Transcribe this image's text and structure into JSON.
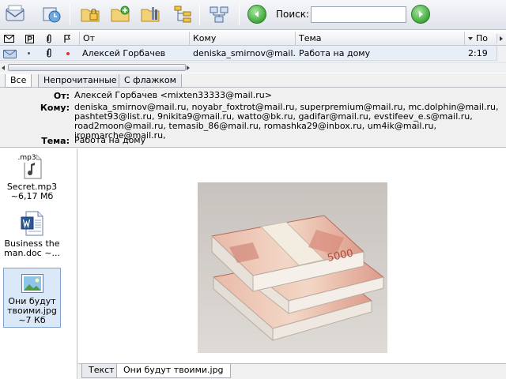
{
  "toolbar": {
    "buttons": [
      {
        "name": "mail-icon"
      },
      {
        "name": "sync-icon"
      },
      {
        "name": "lock-folder-icon"
      },
      {
        "name": "add-folder-icon"
      },
      {
        "name": "folder-settings-icon"
      },
      {
        "name": "tree-icon"
      },
      {
        "name": "network-icon"
      }
    ],
    "search_label": "Поиск:",
    "search_value": "",
    "search_placeholder": ""
  },
  "list": {
    "columns": {
      "from": "От",
      "to": "Кому",
      "subject": "Тема",
      "time": "По"
    },
    "rows": [
      {
        "from": "Алексей Горбачев",
        "to": "deniska_smirnov@mail....",
        "subject": "Работа на дому",
        "time": "2:19"
      }
    ]
  },
  "filters": {
    "all": "Все",
    "unread": "Непрочитанные",
    "flagged": "С флажком"
  },
  "message": {
    "from_label": "От:",
    "from": "Алексей Горбачев <mixten33333@mail.ru>",
    "to_label": "Кому:",
    "to_lines": [
      "deniska_smirnov@mail.ru, noyabr_foxtrot@mail.ru, superpremium@mail.ru, mc.dolphin@mail.ru,",
      "pashtet93@list.ru, 9nikita9@mail.ru, watto@bk.ru, gadifar@mail.ru, evstifeev_e.s@mail.ru,",
      "road2moon@mail.ru, temasib_86@mail.ru, romashka29@inbox.ru, um4ik@mail.ru, ironmarche@mail.ru,"
    ],
    "subject_label": "Тема:",
    "subject": "Работа на дому"
  },
  "attachments": [
    {
      "icon": "mp3-icon",
      "badge": ".mp3",
      "lines": [
        "Secret.mp3",
        "~6,17 Мб"
      ]
    },
    {
      "icon": "word-doc-icon",
      "lines": [
        "Business the",
        "man.doc ~..."
      ]
    },
    {
      "icon": "image-file-icon",
      "lines": [
        "Они будут",
        "твоими.jpg",
        "~7 Кб"
      ],
      "selected": true
    }
  ],
  "bottom_tabs": {
    "text": "Текст",
    "image": "Они будут твоими.jpg"
  },
  "banknote": {
    "denomination": "5000"
  },
  "colors": {
    "nav_green": "#3fa93a",
    "selection": "#dbe8f7",
    "note_red": "#d96a6a",
    "flag_red": "#d9342b"
  }
}
